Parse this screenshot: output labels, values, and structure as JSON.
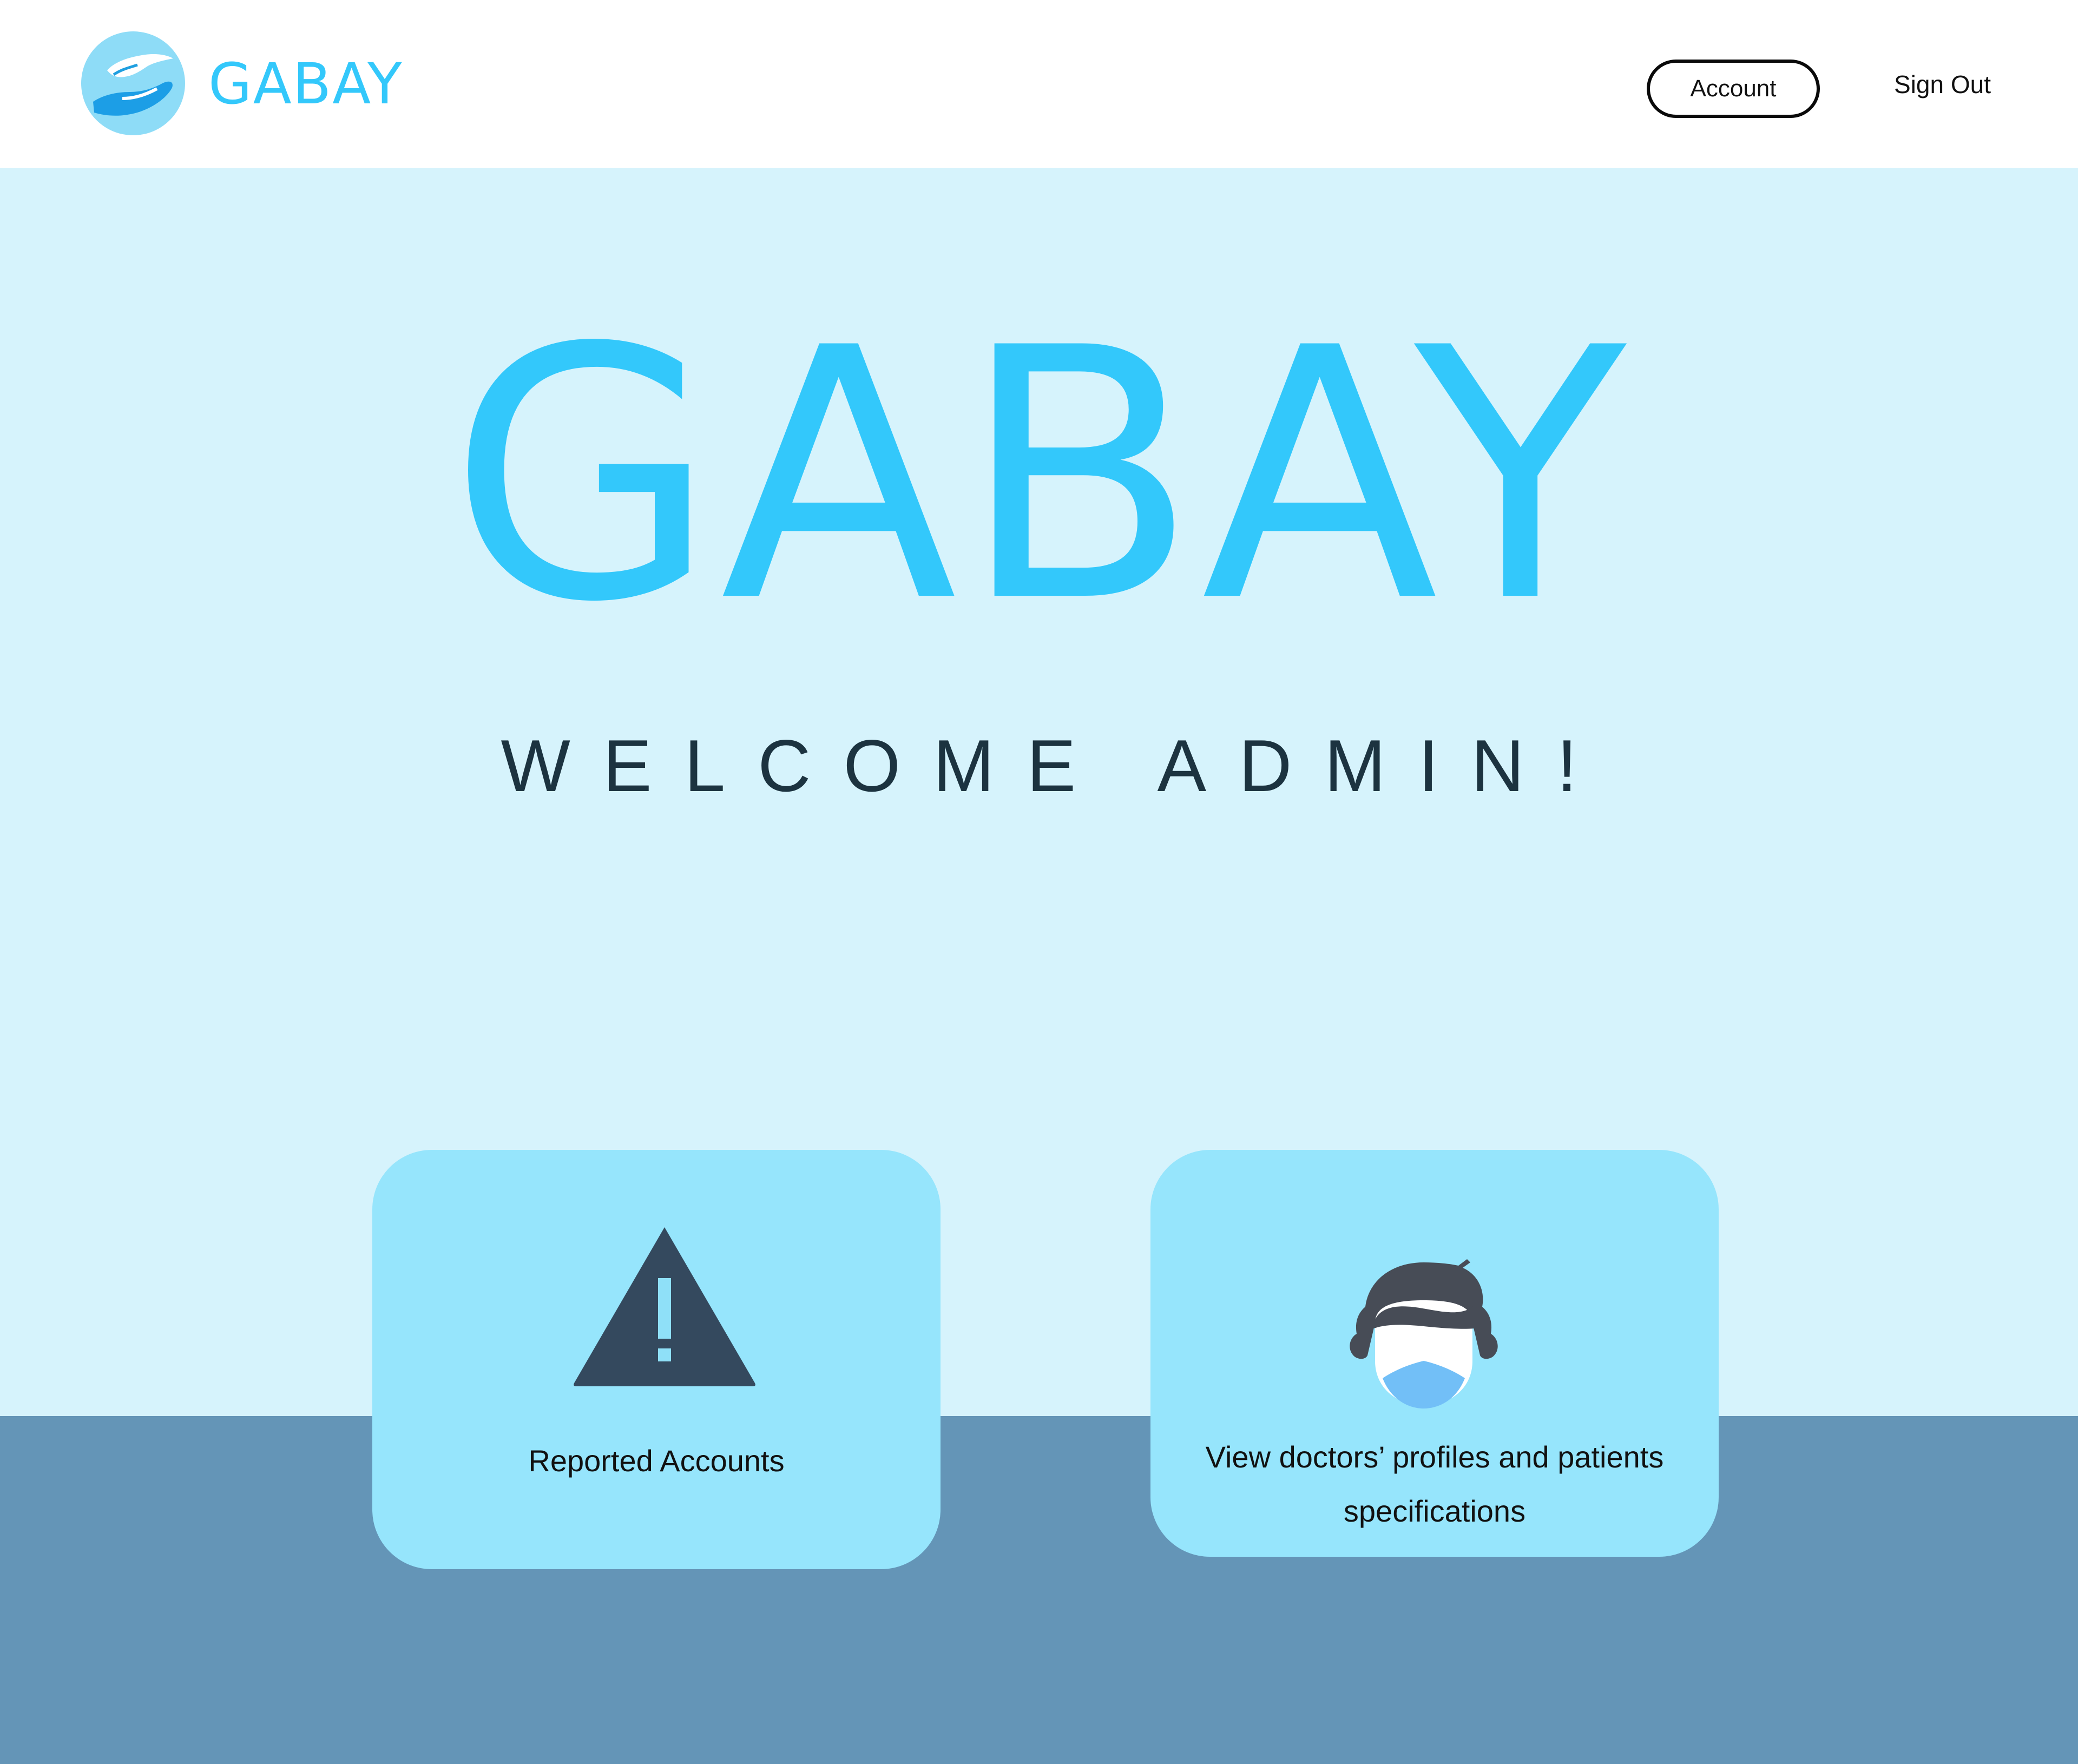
{
  "header": {
    "brand": "GABAY",
    "logo_icon": "helping-hands-logo",
    "account_label": "Account",
    "signout_label": "Sign Out"
  },
  "hero": {
    "title": "GABAY",
    "subtitle": "WELCOME ADMIN!"
  },
  "cards": [
    {
      "icon": "warning-icon",
      "label": "Reported Accounts"
    },
    {
      "icon": "doctor-icon",
      "label": "View doctors’ profiles and patients specifications"
    }
  ],
  "colors": {
    "brand": "#33c8fb",
    "hero_bg": "#d6f3fc",
    "card_bg": "#96e5fc",
    "band_bg": "#6495b7",
    "heading_text": "#1c3340"
  }
}
